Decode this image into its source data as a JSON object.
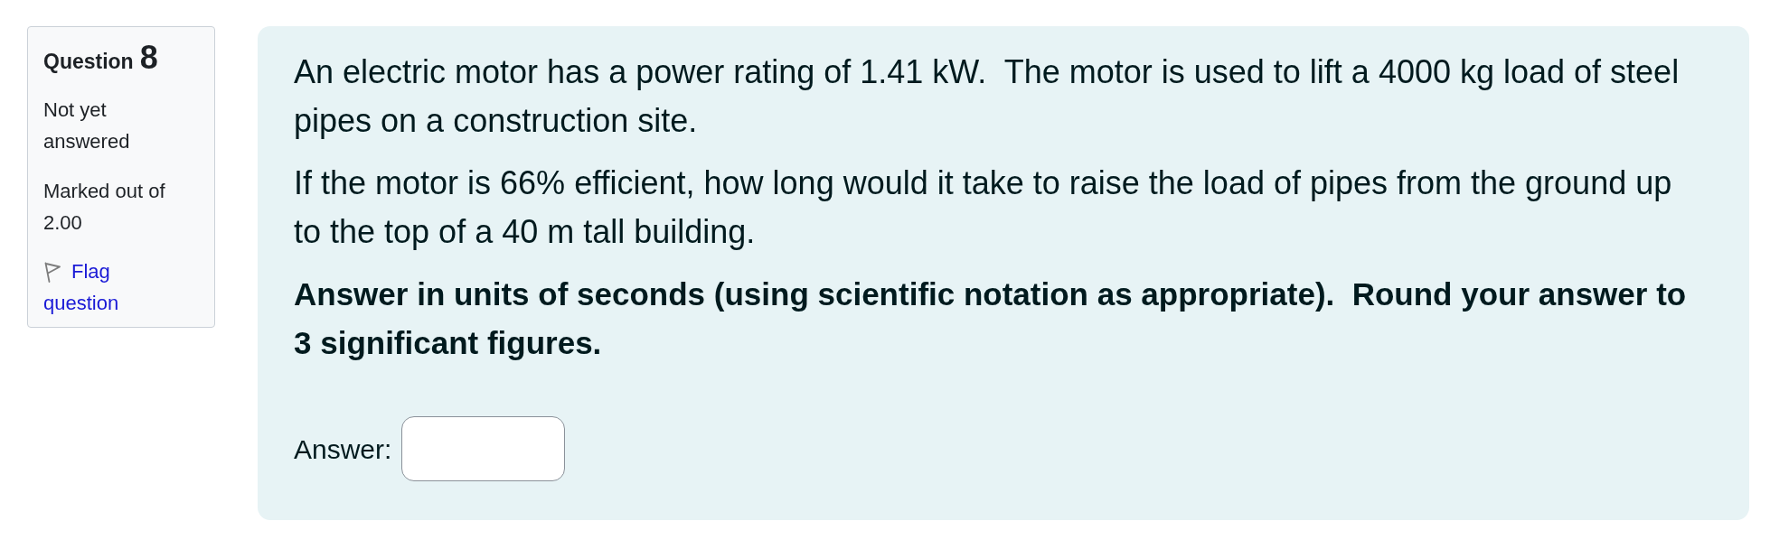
{
  "question_info": {
    "label": "Question",
    "number": "8",
    "state": "Not yet answered",
    "marks": "Marked out of 2.00",
    "flag_link": "Flag question"
  },
  "question": {
    "paragraphs": [
      {
        "kind": "text",
        "text": "An electric motor has a power rating of 1.41 kW.  The motor is used to lift a 4000 kg load of steel pipes on a construction site."
      },
      {
        "kind": "text",
        "text": "If the motor is 66% efficient, how long would it take to raise the load of pipes from the ground up to the top of a 40 m tall building."
      },
      {
        "kind": "instruction",
        "text": "Answer in units of seconds (using scientific notation as appropriate).  Round your answer to 3 significant figures."
      }
    ],
    "answer": {
      "label": "Answer:"
    }
  }
}
